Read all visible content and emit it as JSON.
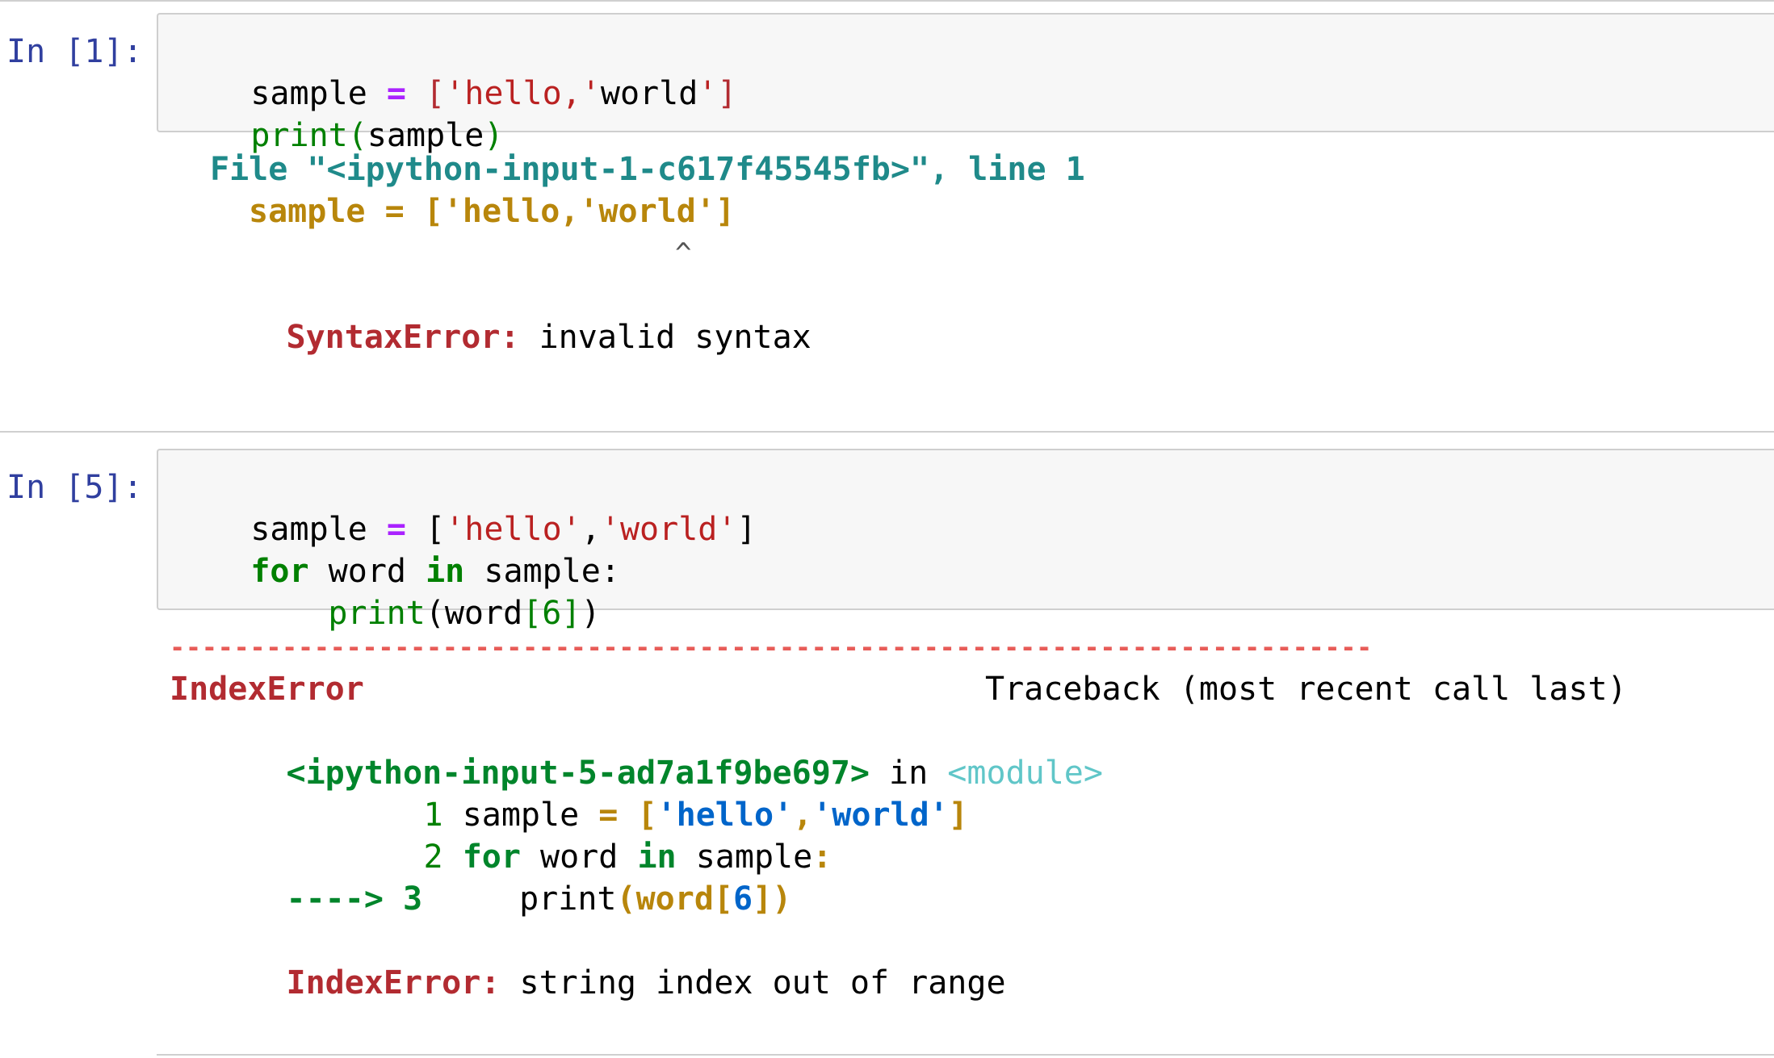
{
  "cells": [
    {
      "prompt": "In [1]:",
      "code_line1": {
        "var": "sample",
        "eq": "=",
        "open": "[",
        "s1": "'hello,'",
        "s2": "world",
        "s3": "'",
        "close": "]"
      },
      "code_line2": {
        "fn": "print",
        "paren_open": "(",
        "arg": "sample",
        "paren_close": ")"
      },
      "output": {
        "file_line": "File \"<ipython-input-1-c617f45545fb>\", line 1",
        "src_line": "sample = ['hello,'world']",
        "caret": "^",
        "err_name": "SyntaxError",
        "err_colon": ":",
        "err_msg": " invalid syntax"
      }
    },
    {
      "prompt": "In [5]:",
      "code_line1": {
        "var": "sample",
        "eq": "=",
        "open": "[",
        "s1": "'hello'",
        "comma": ",",
        "s2": "'world'",
        "close": "]"
      },
      "code_line2": {
        "kw_for": "for",
        "mid": "word",
        "kw_in": "in",
        "tail": "sample:"
      },
      "code_line3": {
        "fn": "print",
        "open": "(word",
        "idx_open": "[",
        "idx": "6",
        "idx_close": "]",
        "close": ")"
      },
      "output": {
        "dashes": "---------------------------------------------------------------------------",
        "err_name": "IndexError",
        "traceback_label": "Traceback (most recent call last)",
        "module_line_a": "<ipython-input-5-ad7a1f9be697>",
        "module_line_b": " in ",
        "module_line_c": "<module>",
        "tb1_num": "1",
        "tb1_a": "sample ",
        "tb1_eq": "=",
        "tb1_open": " [",
        "tb1_s1": "'hello'",
        "tb1_comma": ",",
        "tb1_s2": "'world'",
        "tb1_close": "]",
        "tb2_num": "2",
        "tb2_for": "for",
        "tb2_mid": " word ",
        "tb2_in": "in",
        "tb2_tail": " sample",
        "tb2_colon": ":",
        "tb3_arrow": "----> 3",
        "tb3_a": "print",
        "tb3_b": "(word",
        "tb3_c": "[",
        "tb3_d": "6",
        "tb3_e": "]",
        "tb3_f": ")",
        "final_name": "IndexError",
        "final_colon": ":",
        "final_msg": " string index out of range"
      }
    }
  ]
}
